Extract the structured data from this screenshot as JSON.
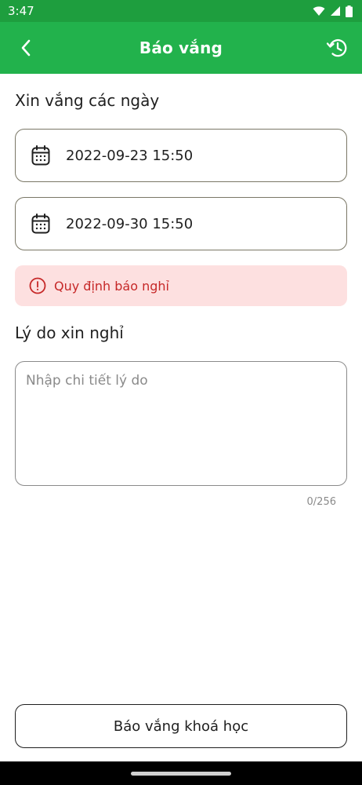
{
  "status_bar": {
    "time": "3:47"
  },
  "app_bar": {
    "title": "Báo vắng"
  },
  "dates_section": {
    "label": "Xin vắng các ngày",
    "start_date": "2022-09-23 15:50",
    "end_date": "2022-09-30 15:50"
  },
  "notice": {
    "text": "Quy định báo nghỉ"
  },
  "reason_section": {
    "label": "Lý do xin nghỉ",
    "placeholder": "Nhập chi tiết lý do",
    "value": "",
    "counter": "0/256"
  },
  "submit": {
    "label": "Báo vắng khoá học"
  },
  "colors": {
    "app_bar": "#22b24c",
    "status_bar": "#1e9e3e",
    "notice_bg": "#fde0e0",
    "notice_text": "#c62828"
  },
  "icons": {
    "back": "chevron-left-icon",
    "history": "history-icon",
    "calendar": "calendar-icon",
    "notice": "alert-circle-icon"
  }
}
